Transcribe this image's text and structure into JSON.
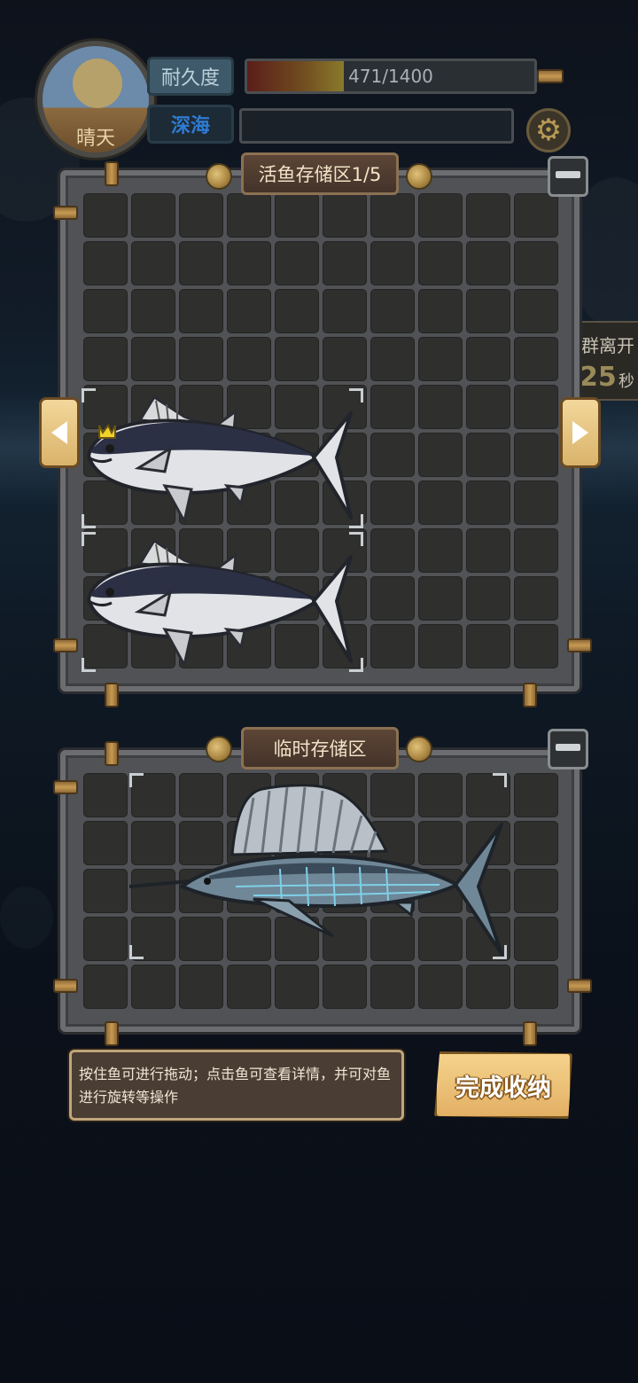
{
  "hud": {
    "weather_label": "晴天",
    "durability_label": "耐久度",
    "durability_text": "471/1400",
    "durability_fraction": 0.336,
    "depth_label": "深海",
    "settings_icon": "gear-icon"
  },
  "live_storage": {
    "title": "活鱼存储区1/5",
    "rows": 10,
    "cols": 10
  },
  "temp_storage": {
    "title": "临时存储区",
    "rows": 5,
    "cols": 10
  },
  "side_info": {
    "text": "群离开",
    "number": "25",
    "unit": "秒"
  },
  "hint": {
    "text": "按住鱼可进行拖动；点击鱼可查看详情，并可对鱼进行旋转等操作"
  },
  "finish_button": {
    "label": "完成收纳"
  },
  "icons": {
    "prev": "left-arrow-icon",
    "next": "right-arrow-icon"
  }
}
